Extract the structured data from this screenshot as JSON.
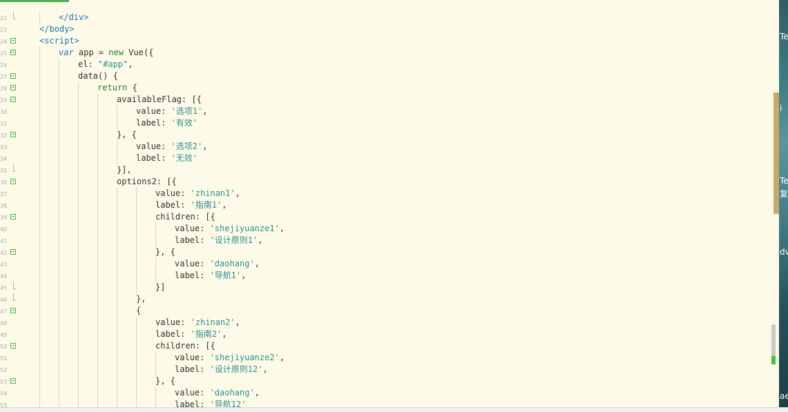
{
  "editor": {
    "lines": [
      {
        "n": "22",
        "fold": "end",
        "indent": 1,
        "tokens": [
          {
            "c": "tag",
            "t": "</div>"
          }
        ]
      },
      {
        "n": "23",
        "fold": "",
        "indent": 0,
        "tokens": [
          {
            "c": "tag",
            "t": "</body>"
          }
        ]
      },
      {
        "n": "24",
        "fold": "box",
        "indent": 0,
        "tokens": [
          {
            "c": "tag",
            "t": "<script>"
          }
        ]
      },
      {
        "n": "25",
        "fold": "box",
        "indent": 1,
        "tokens": [
          {
            "c": "var",
            "t": "var"
          },
          {
            "c": "",
            "t": " app = "
          },
          {
            "c": "kw",
            "t": "new"
          },
          {
            "c": "",
            "t": " Vue({"
          }
        ]
      },
      {
        "n": "26",
        "fold": "",
        "indent": 2,
        "tokens": [
          {
            "c": "",
            "t": "el: "
          },
          {
            "c": "str",
            "t": "\"#app\""
          },
          {
            "c": "",
            "t": ","
          }
        ]
      },
      {
        "n": "27",
        "fold": "box",
        "indent": 2,
        "tokens": [
          {
            "c": "",
            "t": "data() {"
          }
        ]
      },
      {
        "n": "28",
        "fold": "box",
        "indent": 3,
        "tokens": [
          {
            "c": "kw",
            "t": "return"
          },
          {
            "c": "",
            "t": " {"
          }
        ]
      },
      {
        "n": "29",
        "fold": "box",
        "indent": 4,
        "tokens": [
          {
            "c": "",
            "t": "availableFlag: [{"
          }
        ]
      },
      {
        "n": "30",
        "fold": "",
        "indent": 5,
        "tokens": [
          {
            "c": "",
            "t": "value: "
          },
          {
            "c": "str",
            "t": "'选项1'"
          },
          {
            "c": "",
            "t": ","
          }
        ]
      },
      {
        "n": "31",
        "fold": "",
        "indent": 5,
        "tokens": [
          {
            "c": "",
            "t": "label: "
          },
          {
            "c": "str",
            "t": "'有效'"
          }
        ]
      },
      {
        "n": "32",
        "fold": "box",
        "indent": 4,
        "tokens": [
          {
            "c": "",
            "t": "}, {"
          }
        ]
      },
      {
        "n": "33",
        "fold": "",
        "indent": 5,
        "tokens": [
          {
            "c": "",
            "t": "value: "
          },
          {
            "c": "str",
            "t": "'选项2'"
          },
          {
            "c": "",
            "t": ","
          }
        ]
      },
      {
        "n": "34",
        "fold": "",
        "indent": 5,
        "tokens": [
          {
            "c": "",
            "t": "label: "
          },
          {
            "c": "str",
            "t": "'无效'"
          }
        ]
      },
      {
        "n": "35",
        "fold": "end",
        "indent": 4,
        "tokens": [
          {
            "c": "",
            "t": "}],"
          }
        ]
      },
      {
        "n": "36",
        "fold": "box",
        "indent": 4,
        "tokens": [
          {
            "c": "",
            "t": "options2: [{"
          }
        ]
      },
      {
        "n": "37",
        "fold": "",
        "indent": 6,
        "tokens": [
          {
            "c": "",
            "t": "value: "
          },
          {
            "c": "str",
            "t": "'zhinan1'"
          },
          {
            "c": "",
            "t": ","
          }
        ]
      },
      {
        "n": "38",
        "fold": "",
        "indent": 6,
        "tokens": [
          {
            "c": "",
            "t": "label: "
          },
          {
            "c": "str",
            "t": "'指南1'"
          },
          {
            "c": "",
            "t": ","
          }
        ]
      },
      {
        "n": "39",
        "fold": "box",
        "indent": 6,
        "tokens": [
          {
            "c": "",
            "t": "children: [{"
          }
        ]
      },
      {
        "n": "40",
        "fold": "",
        "indent": 7,
        "tokens": [
          {
            "c": "",
            "t": "value: "
          },
          {
            "c": "str",
            "t": "'shejiyuanze1'"
          },
          {
            "c": "",
            "t": ","
          }
        ]
      },
      {
        "n": "41",
        "fold": "",
        "indent": 7,
        "tokens": [
          {
            "c": "",
            "t": "label: "
          },
          {
            "c": "str",
            "t": "'设计原则1'"
          },
          {
            "c": "",
            "t": ","
          }
        ]
      },
      {
        "n": "42",
        "fold": "box",
        "indent": 6,
        "tokens": [
          {
            "c": "",
            "t": "}, {"
          }
        ]
      },
      {
        "n": "43",
        "fold": "",
        "indent": 7,
        "tokens": [
          {
            "c": "",
            "t": "value: "
          },
          {
            "c": "str",
            "t": "'daohang'"
          },
          {
            "c": "",
            "t": ","
          }
        ]
      },
      {
        "n": "44",
        "fold": "",
        "indent": 7,
        "tokens": [
          {
            "c": "",
            "t": "label: "
          },
          {
            "c": "str",
            "t": "'导航1'"
          },
          {
            "c": "",
            "t": ","
          }
        ]
      },
      {
        "n": "45",
        "fold": "end",
        "indent": 6,
        "tokens": [
          {
            "c": "",
            "t": "}]"
          }
        ]
      },
      {
        "n": "46",
        "fold": "end",
        "indent": 5,
        "tokens": [
          {
            "c": "",
            "t": "},"
          }
        ]
      },
      {
        "n": "47",
        "fold": "box",
        "indent": 5,
        "tokens": [
          {
            "c": "",
            "t": "{"
          }
        ]
      },
      {
        "n": "48",
        "fold": "",
        "indent": 6,
        "tokens": [
          {
            "c": "",
            "t": "value: "
          },
          {
            "c": "str",
            "t": "'zhinan2'"
          },
          {
            "c": "",
            "t": ","
          }
        ]
      },
      {
        "n": "49",
        "fold": "",
        "indent": 6,
        "tokens": [
          {
            "c": "",
            "t": "label: "
          },
          {
            "c": "str",
            "t": "'指南2'"
          },
          {
            "c": "",
            "t": ","
          }
        ]
      },
      {
        "n": "50",
        "fold": "box",
        "indent": 6,
        "tokens": [
          {
            "c": "",
            "t": "children: [{"
          }
        ]
      },
      {
        "n": "51",
        "fold": "",
        "indent": 7,
        "tokens": [
          {
            "c": "",
            "t": "value: "
          },
          {
            "c": "str",
            "t": "'shejiyuanze2'"
          },
          {
            "c": "",
            "t": ","
          }
        ]
      },
      {
        "n": "52",
        "fold": "",
        "indent": 7,
        "tokens": [
          {
            "c": "",
            "t": "label: "
          },
          {
            "c": "str",
            "t": "'设计原则12'"
          },
          {
            "c": "",
            "t": ","
          }
        ]
      },
      {
        "n": "53",
        "fold": "box",
        "indent": 6,
        "tokens": [
          {
            "c": "",
            "t": "}, {"
          }
        ]
      },
      {
        "n": "54",
        "fold": "",
        "indent": 7,
        "tokens": [
          {
            "c": "",
            "t": "value: "
          },
          {
            "c": "str",
            "t": "'daohang'"
          },
          {
            "c": "",
            "t": ","
          }
        ]
      },
      {
        "n": "55",
        "fold": "",
        "indent": 7,
        "tokens": [
          {
            "c": "",
            "t": "label: "
          },
          {
            "c": "str",
            "t": "'导航12'"
          }
        ]
      }
    ]
  },
  "side_panel": {
    "labels": [
      "Te",
      "i",
      "Te",
      "复",
      "dv",
      "ae"
    ]
  },
  "colors": {
    "background": "#fdfbe8",
    "keyword": "#2a7a2a",
    "string": "#2a8f8f",
    "tag": "#1f6fbf"
  }
}
